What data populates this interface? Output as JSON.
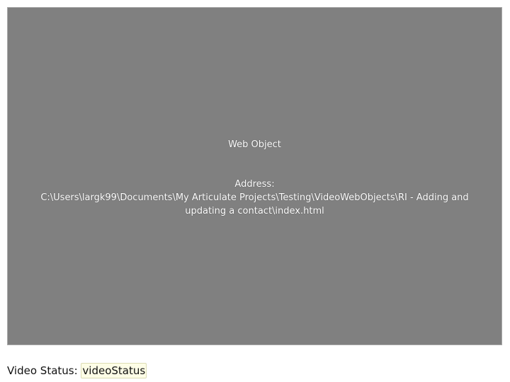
{
  "web_object": {
    "title": "Web Object",
    "address_label": "Address:",
    "address_path": "C:\\Users\\largk99\\Documents\\My Articulate Projects\\Testing\\VideoWebObjects\\RI - Adding and updating a contact\\index.html",
    "background_color": "#808080"
  },
  "status": {
    "label": "Video Status: ",
    "value": "videoStatus"
  }
}
